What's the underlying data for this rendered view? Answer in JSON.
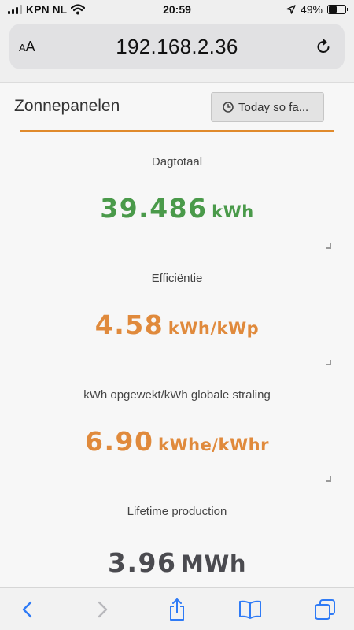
{
  "status_bar": {
    "carrier": "KPN NL",
    "time": "20:59",
    "battery_percent": "49%",
    "battery_level": 0.49
  },
  "browser": {
    "aa_label_small": "A",
    "aa_label_large": "A",
    "url": "192.168.2.36"
  },
  "panel": {
    "title": "Zonnepanelen",
    "time_range_label": "Today so fa..."
  },
  "stats": [
    {
      "label": "Dagtotaal",
      "value": "39.486",
      "unit": "kWh",
      "color": "#4a9a4a"
    },
    {
      "label": "Efficiëntie",
      "value": "4.58",
      "unit": "kWh/kWp",
      "color": "#e08a3c"
    },
    {
      "label": "kWh opgewekt/kWh globale straling",
      "value": "6.90",
      "unit": "kWhe/kWhr",
      "color": "#e08a3c"
    },
    {
      "label": "Lifetime production",
      "value": "3.96",
      "unit": "MWh",
      "color": "#4b4b50"
    }
  ],
  "colors": {
    "accent_line": "#e08a2c",
    "ios_blue": "#2f7bf6"
  },
  "toolbar": {
    "icons": [
      "back-icon",
      "forward-icon",
      "share-icon",
      "bookmarks-icon",
      "tabs-icon"
    ]
  }
}
